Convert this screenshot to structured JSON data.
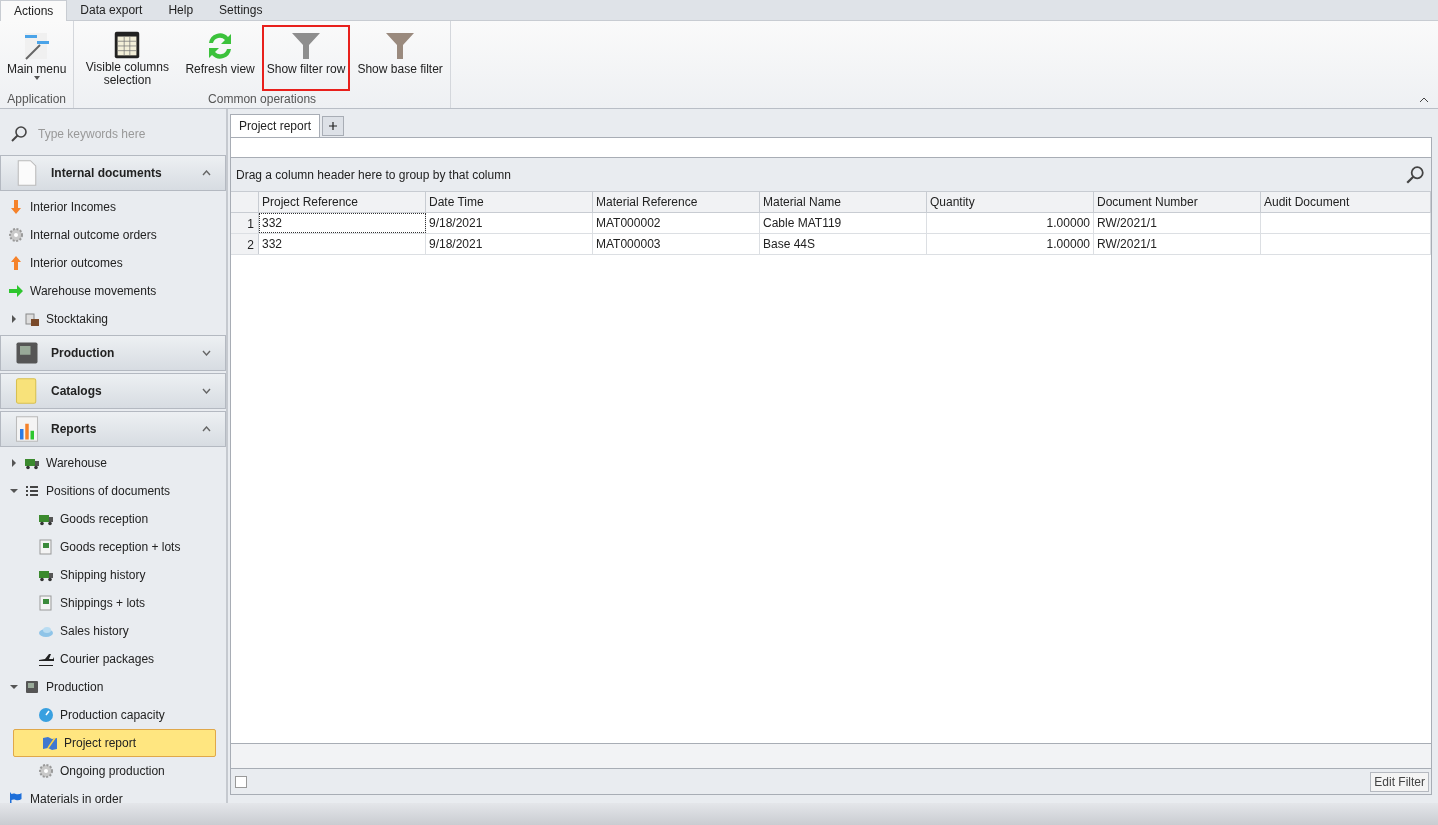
{
  "menu_tabs": [
    {
      "label": "Actions",
      "selected": true
    },
    {
      "label": "Data export",
      "selected": false
    },
    {
      "label": "Help",
      "selected": false
    },
    {
      "label": "Settings",
      "selected": false
    }
  ],
  "ribbon_groups": [
    {
      "label": "Application",
      "buttons": [
        {
          "label": "Main menu",
          "kind": "menu",
          "dropdown": true,
          "highlighted": false
        }
      ]
    },
    {
      "label": "Common operations",
      "buttons": [
        {
          "label": "Visible columns selection",
          "kind": "columns",
          "dropdown": false,
          "highlighted": false
        },
        {
          "label": "Refresh view",
          "kind": "refresh",
          "dropdown": false,
          "highlighted": false
        },
        {
          "label": "Show filter row",
          "kind": "filter",
          "dropdown": false,
          "highlighted": true
        },
        {
          "label": "Show base filter",
          "kind": "basefilter",
          "dropdown": false,
          "highlighted": false
        }
      ]
    }
  ],
  "sidebar": {
    "search": {
      "placeholder": "Type keywords here"
    },
    "groups": [
      {
        "label": "Internal documents",
        "kind": "page",
        "expanded": true,
        "items": [
          {
            "label": "Interior Incomes",
            "kind": "down",
            "selected": false
          },
          {
            "label": "Internal outcome orders",
            "kind": "gear",
            "selected": false
          },
          {
            "label": "Interior outcomes",
            "kind": "up",
            "selected": false
          },
          {
            "label": "Warehouse movements",
            "kind": "right",
            "selected": false
          },
          {
            "label": "Stocktaking",
            "kind": "box",
            "selected": false,
            "expanded": false
          }
        ]
      },
      {
        "label": "Production",
        "kind": "machine",
        "expanded": false
      },
      {
        "label": "Catalogs",
        "kind": "folder",
        "expanded": false
      },
      {
        "label": "Reports",
        "kind": "chart",
        "expanded": true,
        "items": [
          {
            "label": "Warehouse",
            "kind": "truck",
            "selected": false,
            "expanded": false
          },
          {
            "label": "Positions of documents",
            "kind": "list",
            "selected": false,
            "expanded": true,
            "children": [
              {
                "label": "Goods reception",
                "kind": "truck",
                "selected": false
              },
              {
                "label": "Goods reception + lots",
                "kind": "doc",
                "selected": false
              },
              {
                "label": "Shipping history",
                "kind": "truck",
                "selected": false
              },
              {
                "label": "Shippings + lots",
                "kind": "doc",
                "selected": false
              },
              {
                "label": "Sales history",
                "kind": "cloud",
                "selected": false
              },
              {
                "label": "Courier packages",
                "kind": "plane",
                "selected": false
              }
            ]
          },
          {
            "label": "Production",
            "kind": "machine",
            "selected": false,
            "expanded": true,
            "children": [
              {
                "label": "Production capacity",
                "kind": "gauge",
                "selected": false
              },
              {
                "label": "Project report",
                "kind": "map",
                "selected": true
              },
              {
                "label": "Ongoing production",
                "kind": "gear",
                "selected": false
              }
            ]
          },
          {
            "label": "Materials in order",
            "kind": "flag",
            "selected": false
          }
        ]
      }
    ]
  },
  "doc_tabs": [
    {
      "label": "Project report",
      "selected": true
    }
  ],
  "grid": {
    "group_panel": "Drag a column header here to group by that column",
    "columns": [
      {
        "label": "Project Reference",
        "kind": "text"
      },
      {
        "label": "Date Time",
        "kind": "text"
      },
      {
        "label": "Material Reference",
        "kind": "text"
      },
      {
        "label": "Material Name",
        "kind": "text"
      },
      {
        "label": "Quantity",
        "kind": "number"
      },
      {
        "label": "Document Number",
        "kind": "text"
      },
      {
        "label": "Audit Document",
        "kind": "text"
      }
    ],
    "rows": [
      {
        "number": "1",
        "focused": true,
        "cells": [
          "332",
          "9/18/2021",
          "MAT000002",
          "Cable MAT119",
          "1.00000",
          "RW/2021/1",
          ""
        ]
      },
      {
        "number": "2",
        "focused": false,
        "cells": [
          "332",
          "9/18/2021",
          "MAT000003",
          "Base 44S",
          "1.00000",
          "RW/2021/1",
          ""
        ]
      }
    ],
    "filter_enabled": false,
    "edit_filter": "Edit Filter"
  }
}
